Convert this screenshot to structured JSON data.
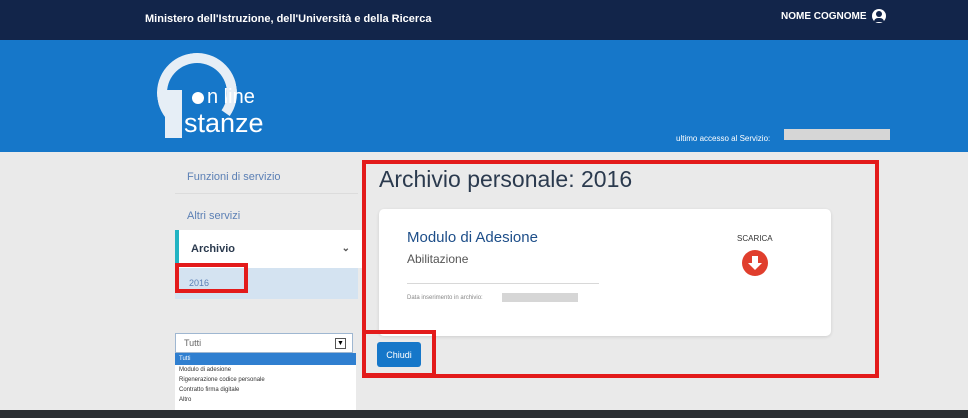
{
  "header": {
    "ministry": "Ministero dell'Istruzione, dell'Università e della Ricerca",
    "user_name": "NOME COGNOME",
    "logo_line1": "n line",
    "logo_line2": "stanze",
    "last_access_label": "ultimo accesso al Servizio:"
  },
  "sidebar": {
    "items": [
      {
        "label": "Funzioni di servizio"
      },
      {
        "label": "Altri servizi"
      },
      {
        "label": "Archivio"
      }
    ],
    "subitem": "2016",
    "filter": {
      "selected": "Tutti",
      "options": [
        "Tutti",
        "Modulo di adesione",
        "Rigenerazione codice personale",
        "Contratto firma digitale",
        "Altro"
      ]
    }
  },
  "main": {
    "title": "Archivio personale: 2016",
    "document": {
      "title": "Modulo di Adesione",
      "subtitle": "Abilitazione",
      "date_label": "Data inserimento in archivio:",
      "download_label": "SCARICA"
    },
    "close_label": "Chiudi"
  },
  "colors": {
    "topbar": "#12254a",
    "banner": "#1677c9",
    "highlight": "#e31b1b",
    "download": "#e03e2d"
  }
}
